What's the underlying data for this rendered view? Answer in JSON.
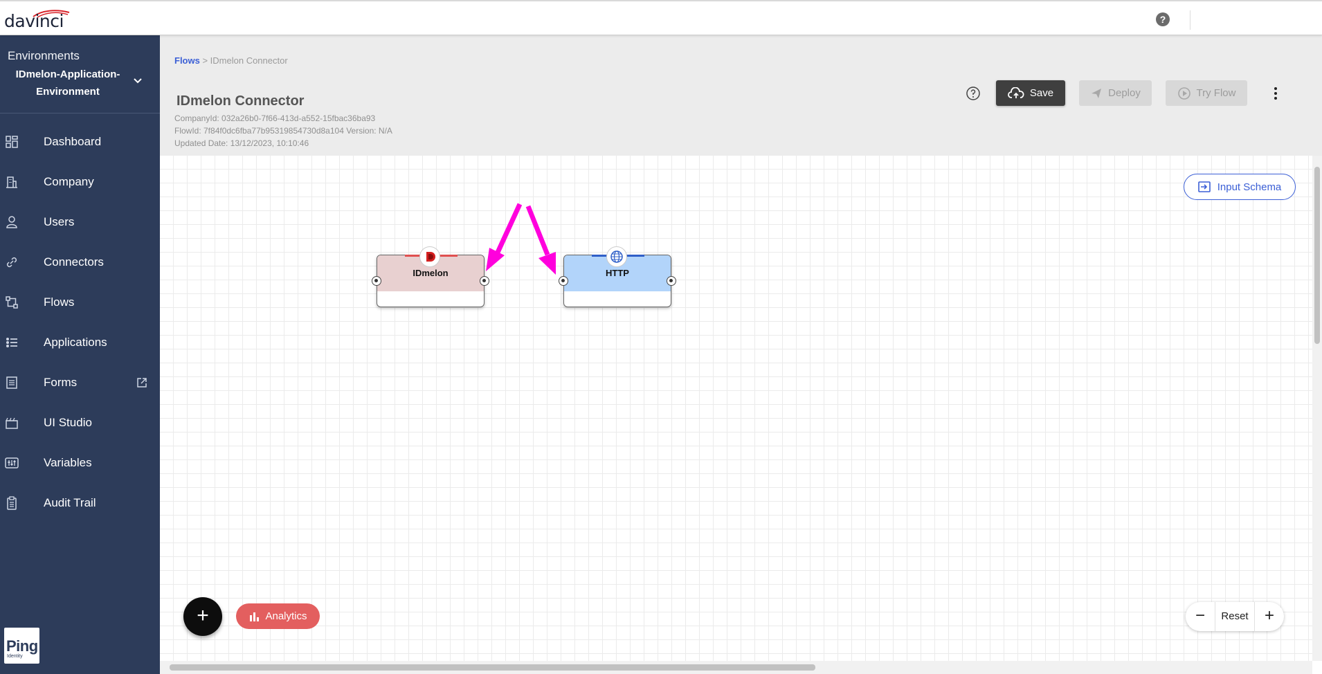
{
  "topbar": {
    "logo_text": "davinci",
    "help_icon": "help-circle-icon"
  },
  "sidebar": {
    "environment_label": "Environments",
    "environment_name": "IDmelon-Application-Environment",
    "items": [
      {
        "label": "Dashboard",
        "icon": "dashboard-icon"
      },
      {
        "label": "Company",
        "icon": "building-icon"
      },
      {
        "label": "Users",
        "icon": "user-icon"
      },
      {
        "label": "Connectors",
        "icon": "link-icon"
      },
      {
        "label": "Flows",
        "icon": "flow-icon"
      },
      {
        "label": "Applications",
        "icon": "list-icon"
      },
      {
        "label": "Forms",
        "icon": "form-icon"
      },
      {
        "label": "UI Studio",
        "icon": "clapper-icon"
      },
      {
        "label": "Variables",
        "icon": "sliders-icon"
      },
      {
        "label": "Audit Trail",
        "icon": "clipboard-icon"
      }
    ],
    "ping_logo_text": "Ping",
    "ping_logo_sub": "Identity"
  },
  "header": {
    "breadcrumb_link": "Flows",
    "breadcrumb_separator": " > ",
    "breadcrumb_current": "IDmelon Connector",
    "title": "IDmelon Connector",
    "company_id": "CompanyId: 032a26b0-7f66-413d-a552-15fbac36ba93",
    "flow_id": "FlowId: 7f84f0dc6fba77b95319854730d8a104 Version: N/A",
    "updated_date": "Updated Date: 13/12/2023, 10:10:46",
    "save_label": "Save",
    "deploy_label": "Deploy",
    "try_flow_label": "Try Flow"
  },
  "canvas": {
    "input_schema_label": "Input Schema",
    "nodes": [
      {
        "label": "IDmelon",
        "color": "#e8d0d0",
        "accent": "#e05050"
      },
      {
        "label": "HTTP",
        "color": "#b2d4fa",
        "accent": "#2f5fc8"
      }
    ],
    "annotation_color": "#ff00dd",
    "add_button_label": "+",
    "analytics_label": "Analytics",
    "zoom_out_label": "−",
    "reset_label": "Reset",
    "zoom_in_label": "+"
  },
  "colors": {
    "sidebar_bg": "#2d3c5a",
    "header_bg": "#ececec",
    "link_blue": "#3b5fd6",
    "analytics_red": "#e35f5f"
  }
}
